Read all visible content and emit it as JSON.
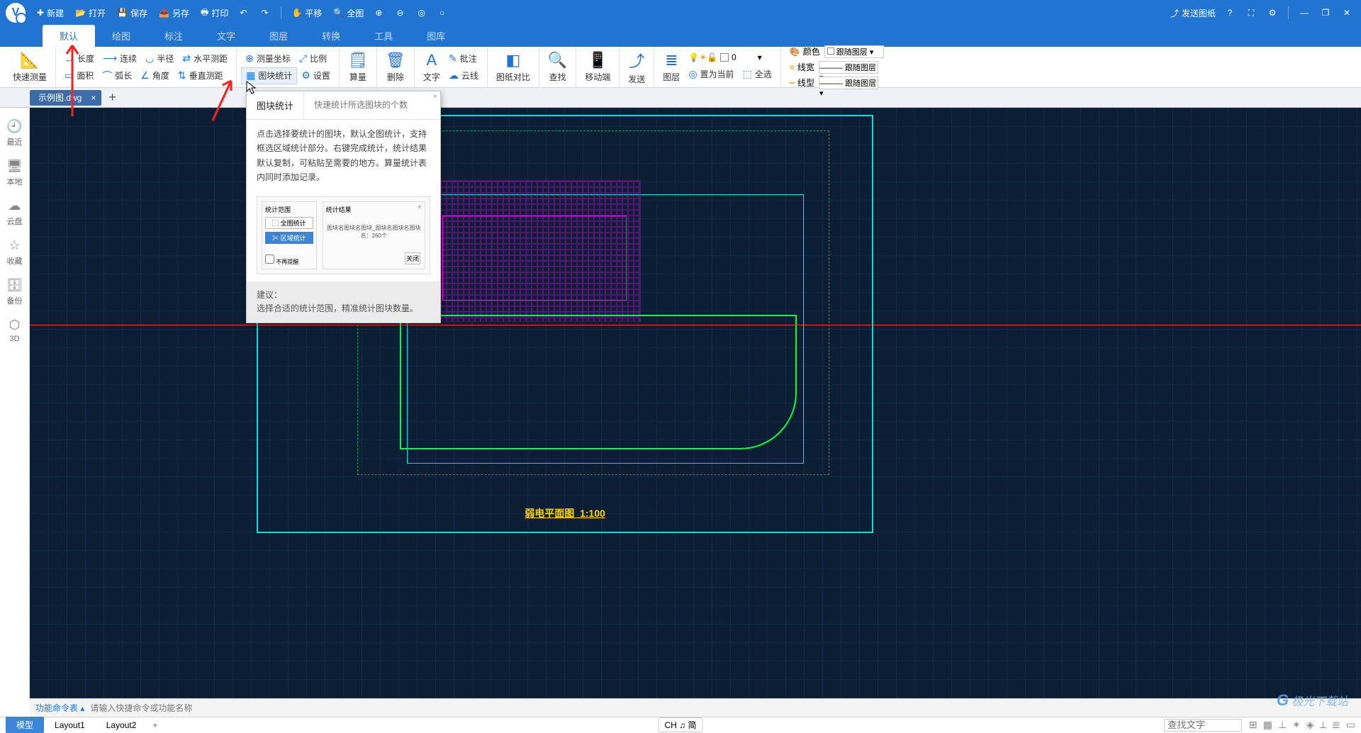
{
  "titlebar": {
    "new": "新建",
    "open": "打开",
    "save": "保存",
    "saveas": "另存",
    "print": "打印",
    "pan": "平移",
    "fullview": "全图",
    "send_drawing": "发送图纸"
  },
  "menu": {
    "tabs": [
      "默认",
      "绘图",
      "标注",
      "文字",
      "图层",
      "转换",
      "工具",
      "图库"
    ],
    "active": 0
  },
  "ribbon": {
    "quick_measure": "快速测量",
    "length": "长度",
    "area": "面积",
    "continuous": "连续",
    "arc": "弧长",
    "radius": "半径",
    "angle": "角度",
    "hdist": "水平测距",
    "vdist": "垂直测距",
    "coord": "测量坐标",
    "block_stat": "图块统计",
    "scale": "比例",
    "settings": "设置",
    "calc": "算量",
    "delete": "删除",
    "text": "文字",
    "annotate": "批注",
    "cloud": "云线",
    "compare": "图纸对比",
    "find": "查找",
    "mobile": "移动端",
    "send": "发送",
    "layer": "图层",
    "set_current": "置为当前",
    "select_all": "全选",
    "color_lbl": "颜色",
    "lw_lbl": "线宽",
    "lt_lbl": "线型",
    "bylayer": "跟随图层",
    "layer_val": "0"
  },
  "file_tabs": {
    "current": "示例图.dwg"
  },
  "sidebar": [
    {
      "icon": "clock-icon",
      "label": "最近"
    },
    {
      "icon": "monitor-icon",
      "label": "本地"
    },
    {
      "icon": "cloud-icon",
      "label": "云盘"
    },
    {
      "icon": "star-icon",
      "label": "收藏"
    },
    {
      "icon": "archive-icon",
      "label": "备份"
    },
    {
      "icon": "cube-icon",
      "label": "3D"
    }
  ],
  "tooltip": {
    "title": "图块统计",
    "subtitle": "快速统计所选图块的个数",
    "body": "点击选择要统计的图块，默认全图统计，支持框选区域统计部分。右键完成统计，统计结果默认复制，可粘贴至需要的地方。算量统计表内同时添加记录。",
    "preview": {
      "panel1_title": "统计范围",
      "btn_full": "全图统计",
      "btn_region": "区域统计",
      "checkbox": "不再提醒",
      "panel2_title": "统计结果",
      "result_text": "图块名图块名图块_图块名图块名图块名：260个",
      "close_btn": "关闭"
    },
    "footer_label": "建议：",
    "footer_text": "选择合适的统计范围，精准统计图块数量。"
  },
  "drawing": {
    "title": "弱电平面图",
    "scale": "1:100"
  },
  "cmdbar": {
    "label": "功能命令表",
    "placeholder": "请输入快捷命令或功能名称"
  },
  "statusbar": {
    "tabs": [
      "模型",
      "Layout1",
      "Layout2"
    ],
    "active": 0,
    "ime": "CH ♫ 简",
    "search_placeholder": "查找文字"
  },
  "watermark": "极光下载站"
}
